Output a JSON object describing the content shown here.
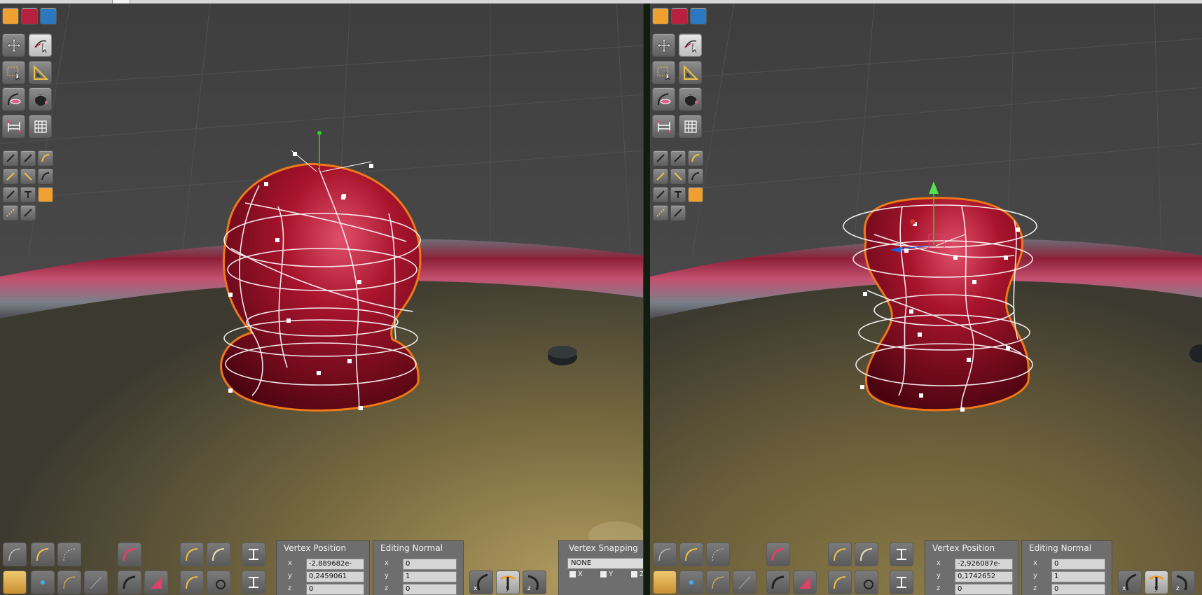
{
  "colors": {
    "floor_bg": "#7a6a40",
    "sky_bg": "#474747",
    "mesh_red": "#a01428",
    "selection_orange": "#f07818",
    "wire_white": "#ffffff",
    "active_tool_orange": "#f0a030"
  },
  "left_view": {
    "vertex_panel": {
      "title": "Vertex Position",
      "x_label": "x",
      "x_value": "-2,889682e-",
      "y_label": "y",
      "y_value": "0,2459061",
      "z_label": "z",
      "z_value": "0"
    },
    "normal_panel": {
      "title": "Editing Normal",
      "x_label": "x",
      "x_value": "0",
      "y_label": "y",
      "y_value": "1",
      "z_label": "z",
      "z_value": "0"
    },
    "snapping_panel": {
      "title": "Vertex Snapping",
      "mode": "NONE",
      "x_label": "X",
      "y_label": "Y",
      "z_label": "Z"
    },
    "axis_buttons": {
      "x": "x",
      "y": "y",
      "z": "z"
    }
  },
  "right_view": {
    "vertex_panel": {
      "title": "Vertex Position",
      "x_label": "x",
      "x_value": "-2,926087e-",
      "y_label": "y",
      "y_value": "0,1742652",
      "z_label": "z",
      "z_value": "0"
    },
    "normal_panel": {
      "title": "Editing Normal",
      "x_label": "x",
      "x_value": "0",
      "y_label": "y",
      "y_value": "1",
      "z_label": "z",
      "z_value": "0"
    },
    "axis_buttons": {
      "x": "x",
      "y": "y",
      "z": "z"
    }
  },
  "toolbar_icons": [
    "spline-mode-yellow-icon",
    "spline-mode-red-icon",
    "spline-mode-blue-icon",
    "move-tool-icon",
    "select-curve-tool-icon",
    "rect-select-icon",
    "measure-triangle-icon",
    "lathe-curve-icon",
    "shell-icon",
    "bridge-icon",
    "grid-icon",
    "edit-point-icons",
    "active-cap-icon"
  ]
}
